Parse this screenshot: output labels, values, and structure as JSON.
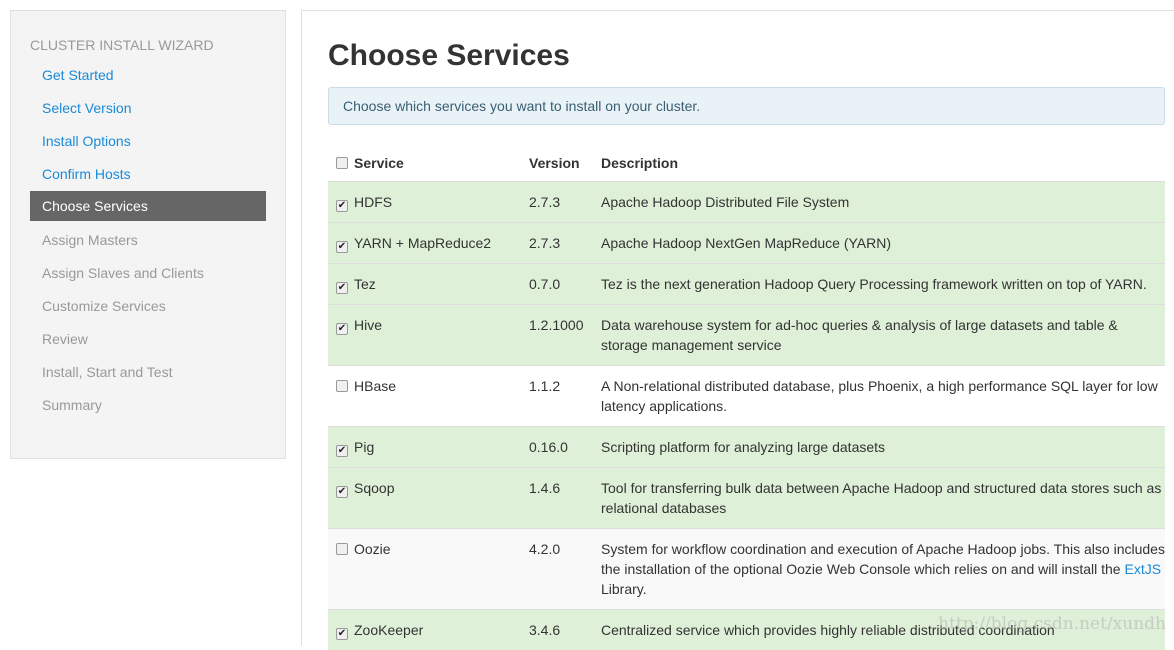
{
  "sidebar": {
    "title": "Cluster Install Wizard",
    "items": [
      {
        "label": "Get Started",
        "state": "done"
      },
      {
        "label": "Select Version",
        "state": "done"
      },
      {
        "label": "Install Options",
        "state": "done"
      },
      {
        "label": "Confirm Hosts",
        "state": "done"
      },
      {
        "label": "Choose Services",
        "state": "active"
      },
      {
        "label": "Assign Masters",
        "state": "pending"
      },
      {
        "label": "Assign Slaves and Clients",
        "state": "pending"
      },
      {
        "label": "Customize Services",
        "state": "pending"
      },
      {
        "label": "Review",
        "state": "pending"
      },
      {
        "label": "Install, Start and Test",
        "state": "pending"
      },
      {
        "label": "Summary",
        "state": "pending"
      }
    ]
  },
  "main": {
    "title": "Choose Services",
    "info": "Choose which services you want to install on your cluster.",
    "columns": {
      "service": "Service",
      "version": "Version",
      "description": "Description"
    },
    "rows": [
      {
        "service": "HDFS",
        "version": "2.7.3",
        "checked": true,
        "description": "Apache Hadoop Distributed File System"
      },
      {
        "service": "YARN + MapReduce2",
        "version": "2.7.3",
        "checked": true,
        "description": "Apache Hadoop NextGen MapReduce (YARN)"
      },
      {
        "service": "Tez",
        "version": "0.7.0",
        "checked": true,
        "description": "Tez is the next generation Hadoop Query Processing framework written on top of YARN."
      },
      {
        "service": "Hive",
        "version": "1.2.1000",
        "checked": true,
        "description": "Data warehouse system for ad-hoc queries & analysis of large datasets and table & storage management service"
      },
      {
        "service": "HBase",
        "version": "1.1.2",
        "checked": false,
        "description": "A Non-relational distributed database, plus Phoenix, a high performance SQL layer for low latency applications."
      },
      {
        "service": "Pig",
        "version": "0.16.0",
        "checked": true,
        "description": "Scripting platform for analyzing large datasets"
      },
      {
        "service": "Sqoop",
        "version": "1.4.6",
        "checked": true,
        "description": "Tool for transferring bulk data between Apache Hadoop and structured data stores such as relational databases"
      },
      {
        "service": "Oozie",
        "version": "4.2.0",
        "checked": false,
        "description": "System for workflow coordination and execution of Apache Hadoop jobs. This also includes the installation of the optional Oozie Web Console which relies on and will install the ",
        "link": "ExtJS",
        "description_after": " Library."
      },
      {
        "service": "ZooKeeper",
        "version": "3.4.6",
        "checked": true,
        "description": "Centralized service which provides highly reliable distributed coordination"
      }
    ]
  },
  "watermark": "http://blog.csdn.net/xundh",
  "colors": {
    "selected_row": "#dff0d8",
    "link": "#1a8ad8",
    "active_nav": "#666666"
  }
}
